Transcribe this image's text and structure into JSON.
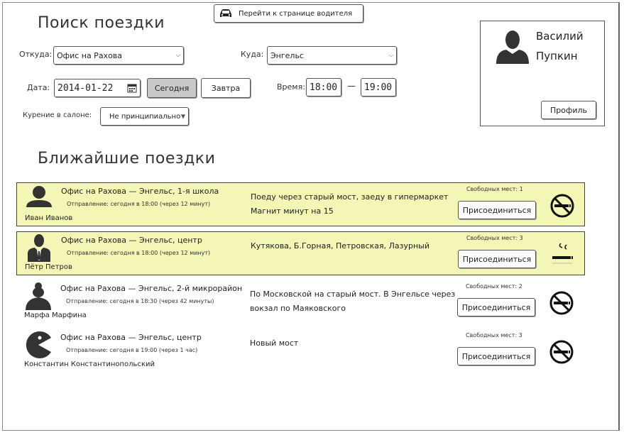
{
  "header": {
    "driver_page_link": "Перейти к странице водителя"
  },
  "search": {
    "title": "Поиск поездки",
    "from_label": "Откуда:",
    "from_value": "Офис на Рахова",
    "to_label": "Куда:",
    "to_value": "Энгельс",
    "date_label": "Дата:",
    "date_value": "2014-01-22",
    "today_label": "Сегодня",
    "tomorrow_label": "Завтра",
    "time_label": "Время:",
    "time_from": "18:00",
    "time_dash": "—",
    "time_to": "19:00",
    "smoking_label": "Курение в салоне:",
    "smoking_value": "Не принципиально"
  },
  "profile": {
    "first_name": "Василий",
    "last_name": "Пупкин",
    "profile_button": "Профиль"
  },
  "trips": {
    "title": "Ближайшие поездки",
    "items": [
      {
        "route": "Офис на Рахова — Энгельс, 1-я школа",
        "departure": "Отправление: сегодня в 18:00 (через 12 минут)",
        "name": "Иван Иванов",
        "comment": "Поеду через старый мост, заеду в гипермаркет Магнит минут на 15",
        "seats": "Свободных мест: 1",
        "join": "Присоединиться",
        "smoking": "no-smoking-icon"
      },
      {
        "route": "Офис на Рахова — Энгельс, центр",
        "departure": "Отправление: сегодня в 18:00 (через 12 минут)",
        "name": "Пётр Петров",
        "comment": "Кутякова, Б.Горная, Петровская, Лазурный",
        "seats": "Свободных мест: 3",
        "join": "Присоединиться",
        "smoking": "smoking-icon"
      },
      {
        "route": "Офис на Рахова — Энгельс, 2-й микрорайон",
        "departure": "Отправление: сегодня в 18:30 (через 42 минуты)",
        "name": "Марфа Марфина",
        "comment": "По Московской на старый мост. В Энгельсе через вокзал по Маяковского",
        "seats": "Свободных мест: 2",
        "join": "Присоединиться",
        "smoking": "no-smoking-icon"
      },
      {
        "route": "Офис на Рахова — Энгельс, центр",
        "departure": "Отправление: сегодня в 19:00 (через 1 час)",
        "name": "Константин Константинопольский",
        "comment": "Новый мост",
        "seats": "Свободных мест: 3",
        "join": "Присоединиться",
        "smoking": "no-smoking-icon"
      }
    ]
  },
  "colors": {
    "highlight": "#f3f6b4",
    "today_button": "#c9c9c9"
  }
}
